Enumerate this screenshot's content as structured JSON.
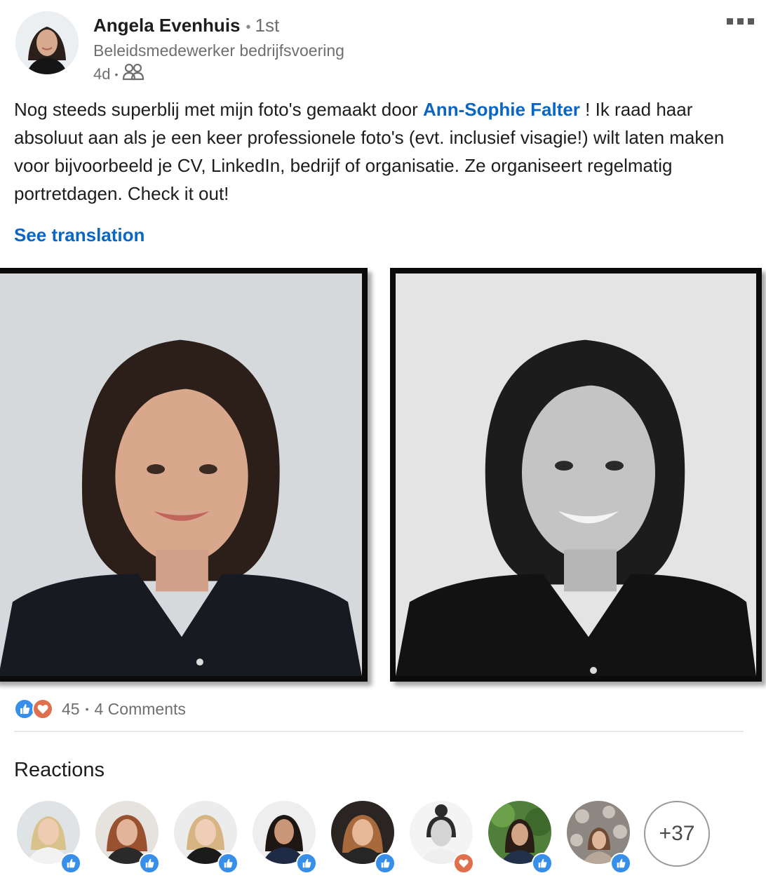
{
  "author": {
    "name": "Angela Evenhuis",
    "connection_degree": "1st",
    "headline": "Beleidsmedewerker bedrijfsvoering",
    "time_ago": "4d",
    "visibility_icon": "connections-icon"
  },
  "post": {
    "text_before": "Nog steeds superblij met mijn foto's gemaakt door ",
    "mention": "Ann-Sophie Falter",
    "text_after": " ! Ik raad haar absoluut aan als je een keer professionele foto's (evt. inclusief visagie!) wilt laten maken voor bijvoorbeeld je CV, LinkedIn, bedrijf of organisatie. Ze organiseert regelmatig portretdagen. Check it out!",
    "see_translation": "See translation"
  },
  "images": [
    {
      "name": "portrait-color",
      "style": "color"
    },
    {
      "name": "portrait-bw",
      "style": "black-and-white"
    }
  ],
  "social": {
    "reaction_icons": [
      "like-icon",
      "love-icon"
    ],
    "reaction_count": "45",
    "comments": "4 Comments"
  },
  "reactions": {
    "title": "Reactions",
    "reactors": [
      {
        "reaction": "like"
      },
      {
        "reaction": "like"
      },
      {
        "reaction": "like"
      },
      {
        "reaction": "like"
      },
      {
        "reaction": "like"
      },
      {
        "reaction": "love"
      },
      {
        "reaction": "like"
      },
      {
        "reaction": "like"
      }
    ],
    "more_count": "+37"
  },
  "colors": {
    "link": "#0a66c2",
    "like": "#378fe9",
    "love": "#df704d",
    "muted_text": "#6f6f6f"
  }
}
